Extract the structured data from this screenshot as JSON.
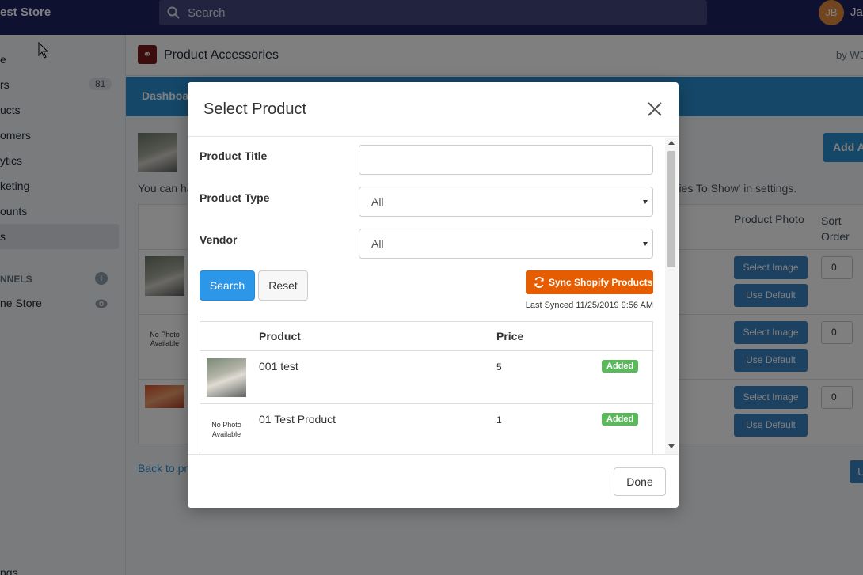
{
  "topbar": {
    "store_name": "est Store",
    "search_placeholder": "Search",
    "avatar_initials": "JB",
    "user_name": "Ja"
  },
  "sidebar": {
    "items": [
      {
        "label": "e"
      },
      {
        "label": "rs",
        "badge": "81"
      },
      {
        "label": "ucts"
      },
      {
        "label": "omers"
      },
      {
        "label": "ytics"
      },
      {
        "label": "keting"
      },
      {
        "label": "ounts"
      },
      {
        "label": "s"
      }
    ],
    "channels_heading": "NNELS",
    "online_store": "ne Store",
    "settings": "ngs"
  },
  "app": {
    "title": "Product Accessories",
    "byline": "by W3",
    "nav_tab": "Dashboar",
    "add_button": "Add A",
    "note_left": "You can ha",
    "note_right": "ories To Show' in settings.",
    "col_product_photo": "Product Photo",
    "col_sort_order": "Sort Order",
    "select_image": "Select Image",
    "use_default": "Use Default",
    "sort_value": "0",
    "no_photo": "No Photo Available",
    "back_link": "Back to pr",
    "right_btn": "U"
  },
  "modal": {
    "title": "Select Product",
    "labels": {
      "product_title": "Product Title",
      "product_type": "Product Type",
      "vendor": "Vendor"
    },
    "fields": {
      "product_title_value": "",
      "product_type_value": "All",
      "vendor_value": "All"
    },
    "buttons": {
      "search": "Search",
      "reset": "Reset",
      "sync": "Sync Shopify Products",
      "done": "Done"
    },
    "last_synced": "Last Synced 11/25/2019 9:56 AM",
    "table": {
      "headers": {
        "product": "Product",
        "price": "Price"
      },
      "rows": [
        {
          "name": "001 test",
          "price": "5",
          "status": "Added",
          "has_photo": true
        },
        {
          "name": "01 Test Product",
          "price": "1",
          "status": "Added",
          "has_photo": false,
          "no_photo_text": "No Photo Available"
        }
      ]
    }
  },
  "colors": {
    "topbar": "#1c2260",
    "accent_blue": "#2b8fd0",
    "sync_orange": "#e65c00",
    "added_green": "#5cb85c"
  }
}
